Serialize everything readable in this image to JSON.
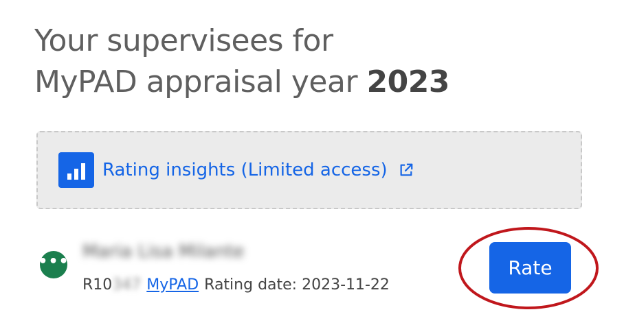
{
  "heading": {
    "line1": "Your supervisees for",
    "line2_prefix": "MyPAD appraisal year ",
    "year": "2023"
  },
  "insights": {
    "icon": "bar-chart-icon",
    "label": "Rating insights (Limited access)",
    "external_icon": "external-link-icon"
  },
  "supervisee": {
    "more_icon": "more-dots-icon",
    "name": "Maria Lisa Milante",
    "ref_prefix": "R10",
    "ref_hidden": "347",
    "link_label": "MyPAD",
    "rating_date_label": "Rating date: 2023-11-22",
    "rate_button": "Rate"
  },
  "colors": {
    "accent": "#1565e6",
    "more_button": "#1b7f4e",
    "annotation": "#c0171c"
  }
}
